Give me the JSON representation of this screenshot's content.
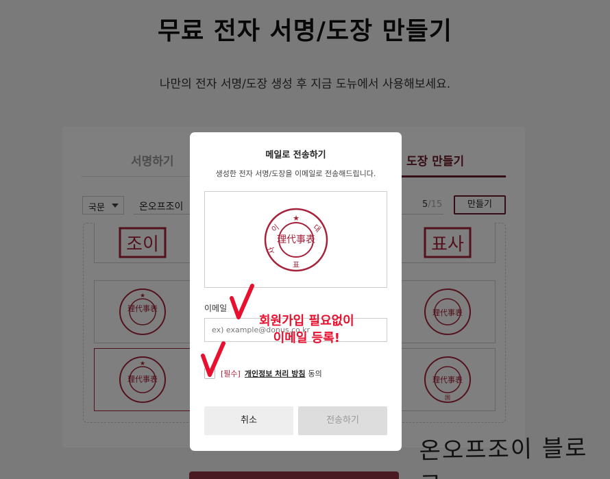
{
  "page": {
    "title": "무료 전자 서명/도장 만들기",
    "subtitle": "나만의 전자 서명/도장 생성 후 지금 도뉴에서 사용해보세요."
  },
  "tabs": {
    "sign": "서명하기",
    "stamp": "도장 만들기"
  },
  "form": {
    "language": "국문",
    "name_value": "온오프조이",
    "char_count": "5",
    "char_max": "/15",
    "make_button": "만들기"
  },
  "stamps": {
    "main_chars": "理代事表",
    "name_chars": [
      "이",
      "사",
      "대",
      "표"
    ],
    "partial_left_chars": "조이",
    "partial_right_chars": "표사",
    "variant_chars": [
      "대",
      "표",
      "이",
      "사",
      "国"
    ],
    "star_glyph": "★"
  },
  "modal": {
    "title": "메일로 전송하기",
    "description": "생성한 전자 서명/도장을 이메일로 전송해드립니다.",
    "email_label": "이메일",
    "email_placeholder": "ex) example@donus.co.kr",
    "required_tag": "[필수]",
    "policy_link": "개인정보 처리 방침",
    "agree_suffix": "동의",
    "cancel": "취소",
    "send": "전송하기"
  },
  "annotation": {
    "line1": "회원가입 필요없이",
    "line2": "이메일 등록!"
  },
  "watermark": "온오프조이 블로그",
  "colors": {
    "brand": "#6b1a28",
    "stamp_red": "#a5223a",
    "annotation_red": "#e8102e"
  }
}
